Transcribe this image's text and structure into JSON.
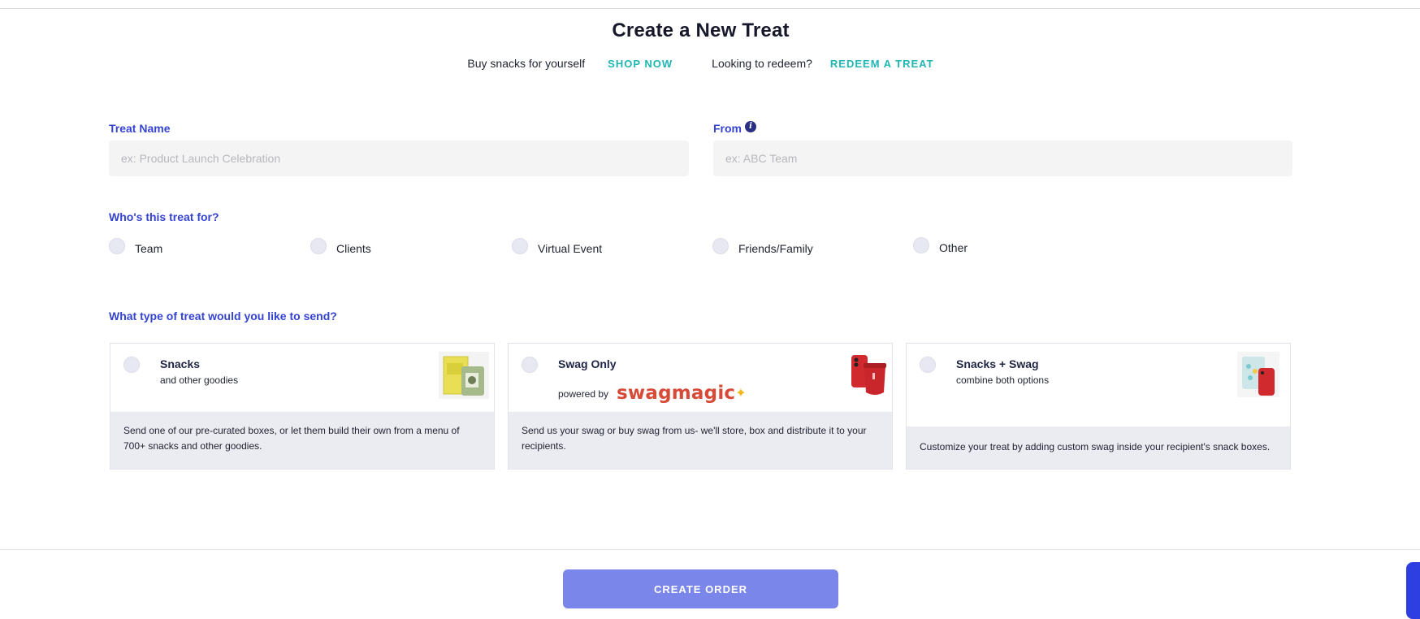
{
  "header": {
    "title": "Create a New Treat",
    "buy_text": "Buy snacks for yourself",
    "shop_link": "SHOP NOW",
    "redeem_text": "Looking to redeem?",
    "redeem_link": "REDEEM A TREAT"
  },
  "form": {
    "treat_name": {
      "label": "Treat Name",
      "placeholder": "ex: Product Launch Celebration",
      "value": ""
    },
    "from": {
      "label": "From",
      "placeholder": "ex: ABC Team",
      "value": "",
      "info_icon": "info-icon"
    },
    "recipient": {
      "label": "Who's this treat for?",
      "options": [
        "Team",
        "Clients",
        "Virtual Event",
        "Friends/Family",
        "Other"
      ],
      "selected": null
    },
    "treat_type": {
      "label": "What type of treat would you like to send?",
      "selected": null,
      "cards": [
        {
          "title": "Snacks",
          "subtitle": "and other goodies",
          "description": "Send one of our pre-curated boxes, or let them build their own from a menu of 700+ snacks and other goodies.",
          "image": "snack-box-image"
        },
        {
          "title": "Swag Only",
          "powered_by": "powered by",
          "brand": "swagmagic",
          "description": "Send us your swag or buy swag from us- we'll store, box and distribute it to your recipients.",
          "image": "swag-phone-tumbler-image"
        },
        {
          "title": "Snacks + Swag",
          "subtitle": "combine both options",
          "description": "Customize your treat by adding custom swag inside your recipient's snack boxes.",
          "image": "snacks-and-swag-image"
        }
      ]
    }
  },
  "footer": {
    "create_button": "CREATE ORDER"
  },
  "colors": {
    "label_blue": "#3543d1",
    "link_teal": "#1fb6b3",
    "button": "#7b86ea",
    "brand_red": "#d64a37",
    "card_footer_bg": "#ebebf2",
    "input_bg": "#f4f4f5"
  }
}
